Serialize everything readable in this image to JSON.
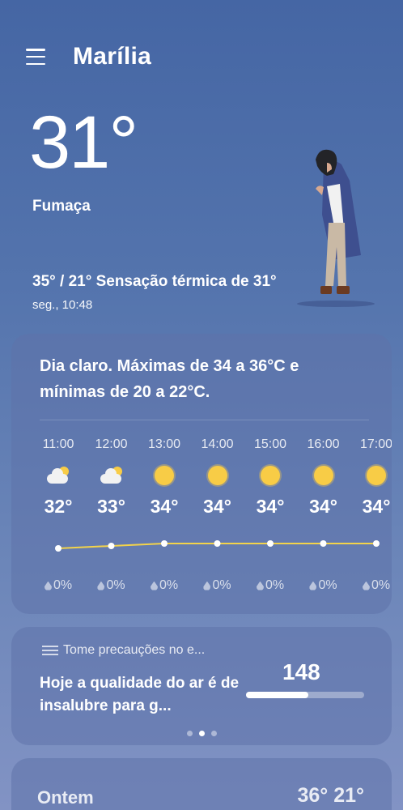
{
  "header": {
    "city": "Marília",
    "menu_icon": "hamburger-menu-icon"
  },
  "current": {
    "temperature": "31°",
    "condition": "Fumaça",
    "range_feels": "35° / 21° Sensação térmica de 31°",
    "datetime": "seg., 10:48"
  },
  "forecast": {
    "summary": "Dia claro. Máximas de 34 a 36°C e mínimas de 20 a 22°C.",
    "hours": [
      {
        "time": "11:00",
        "icon": "partly-cloudy",
        "temp": "32°",
        "rain": "0%"
      },
      {
        "time": "12:00",
        "icon": "partly-cloudy",
        "temp": "33°",
        "rain": "0%"
      },
      {
        "time": "13:00",
        "icon": "sunny",
        "temp": "34°",
        "rain": "0%"
      },
      {
        "time": "14:00",
        "icon": "sunny",
        "temp": "34°",
        "rain": "0%"
      },
      {
        "time": "15:00",
        "icon": "sunny",
        "temp": "34°",
        "rain": "0%"
      },
      {
        "time": "16:00",
        "icon": "sunny",
        "temp": "34°",
        "rain": "0%"
      },
      {
        "time": "17:00",
        "icon": "sunny",
        "temp": "34°",
        "rain": "0%"
      }
    ],
    "trend_color": "#f3d34a"
  },
  "air_quality": {
    "title": "Tome precauções no e...",
    "text": "Hoje a qualidade do ar é de insalubre para g...",
    "aqi": "148",
    "aqi_fraction": 0.53,
    "page_dots": 3,
    "active_dot": 1
  },
  "yesterday": {
    "label": "Ontem",
    "temps": "36° 21°"
  }
}
